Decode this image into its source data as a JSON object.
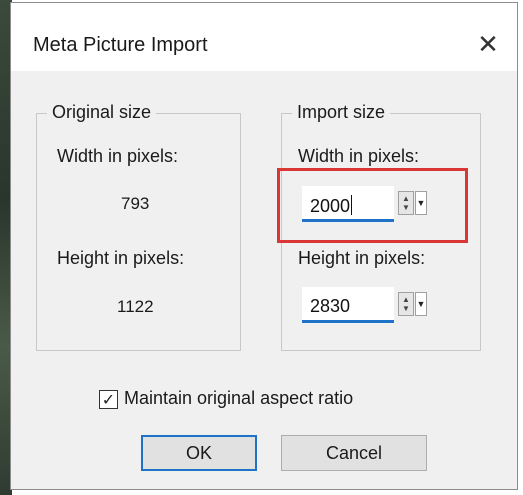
{
  "dialog": {
    "title": "Meta Picture Import",
    "close_label": "✕"
  },
  "original_size": {
    "legend": "Original size",
    "width_label": "Width in pixels:",
    "width_value": "793",
    "height_label": "Height in pixels:",
    "height_value": "1122"
  },
  "import_size": {
    "legend": "Import size",
    "width_label": "Width in pixels:",
    "width_value": "2000",
    "height_label": "Height in pixels:",
    "height_value": "2830"
  },
  "options": {
    "aspect_label": "Maintain original aspect ratio",
    "aspect_checked": true
  },
  "buttons": {
    "ok": "OK",
    "cancel": "Cancel"
  },
  "colors": {
    "accent": "#1e73c8",
    "highlight": "#d93636"
  }
}
